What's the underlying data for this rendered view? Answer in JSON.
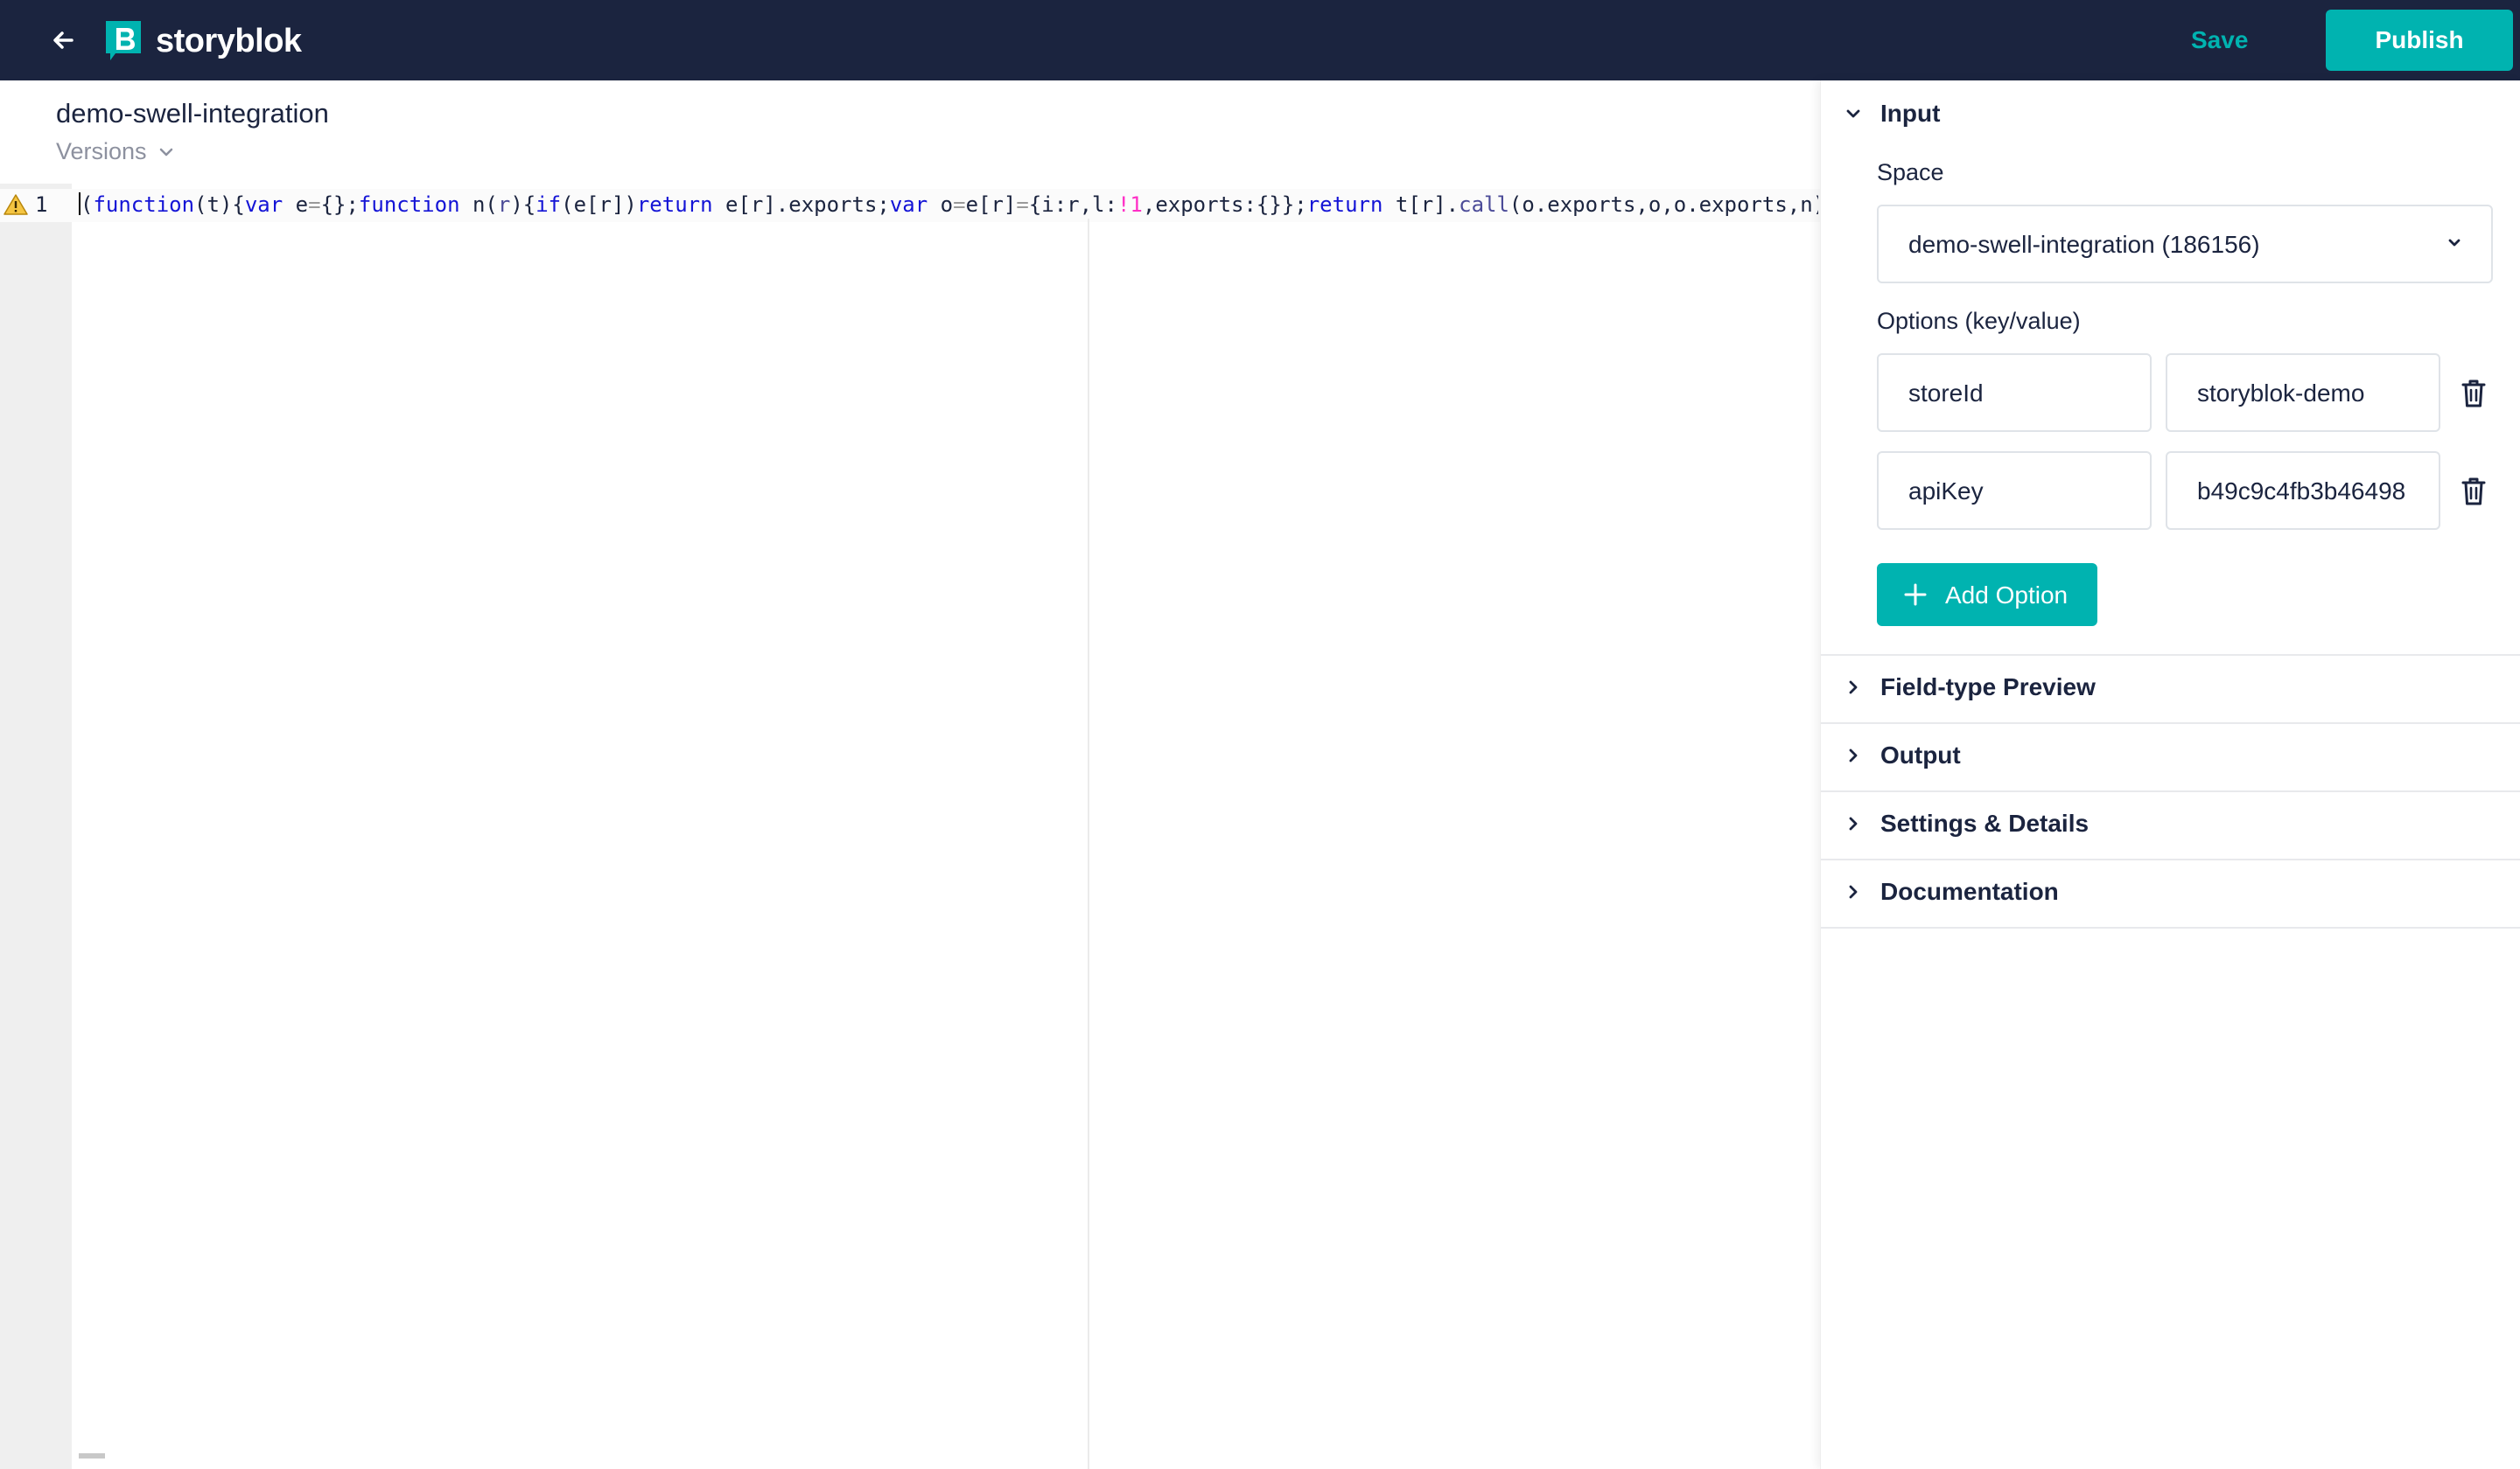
{
  "topbar": {
    "brand": "storyblok",
    "save_label": "Save",
    "publish_label": "Publish"
  },
  "editor": {
    "title": "demo-swell-integration",
    "versions_label": "Versions",
    "line_number": "1",
    "code_segments": [
      {
        "t": "(",
        "c": ""
      },
      {
        "t": "function",
        "c": "kw"
      },
      {
        "t": "(t){",
        "c": ""
      },
      {
        "t": "var",
        "c": "kw"
      },
      {
        "t": " e",
        "c": ""
      },
      {
        "t": "=",
        "c": "op"
      },
      {
        "t": "{};",
        "c": ""
      },
      {
        "t": "function",
        "c": "kw"
      },
      {
        "t": " n(",
        "c": ""
      },
      {
        "t": "r",
        "c": "fn"
      },
      {
        "t": "){",
        "c": ""
      },
      {
        "t": "if",
        "c": "kw"
      },
      {
        "t": "(e[r])",
        "c": ""
      },
      {
        "t": "return",
        "c": "kw"
      },
      {
        "t": " e[r].exports;",
        "c": ""
      },
      {
        "t": "var",
        "c": "kw"
      },
      {
        "t": " o",
        "c": ""
      },
      {
        "t": "=",
        "c": "op"
      },
      {
        "t": "e[r]",
        "c": ""
      },
      {
        "t": "=",
        "c": "op"
      },
      {
        "t": "{i:r,l:",
        "c": ""
      },
      {
        "t": "!1",
        "c": "num"
      },
      {
        "t": ",exports:{}};",
        "c": ""
      },
      {
        "t": "return",
        "c": "kw"
      },
      {
        "t": " t[r].",
        "c": ""
      },
      {
        "t": "call",
        "c": "fn"
      },
      {
        "t": "(o.exports,o,o.exports,n)",
        "c": ""
      }
    ]
  },
  "panel": {
    "input_section": "Input",
    "space_label": "Space",
    "space_value": "demo-swell-integration (186156)",
    "options_label": "Options (key/value)",
    "options": [
      {
        "key": "storeId",
        "value": "storyblok-demo"
      },
      {
        "key": "apiKey",
        "value": "b49c9c4fb3b46498"
      }
    ],
    "add_option_label": "Add Option",
    "sections": [
      {
        "label": "Field-type Preview"
      },
      {
        "label": "Output"
      },
      {
        "label": "Settings & Details"
      },
      {
        "label": "Documentation"
      }
    ]
  },
  "colors": {
    "topbar_bg": "#1b243f",
    "accent": "#00b3b0",
    "text": "#1b243f",
    "muted": "#8d919f"
  }
}
